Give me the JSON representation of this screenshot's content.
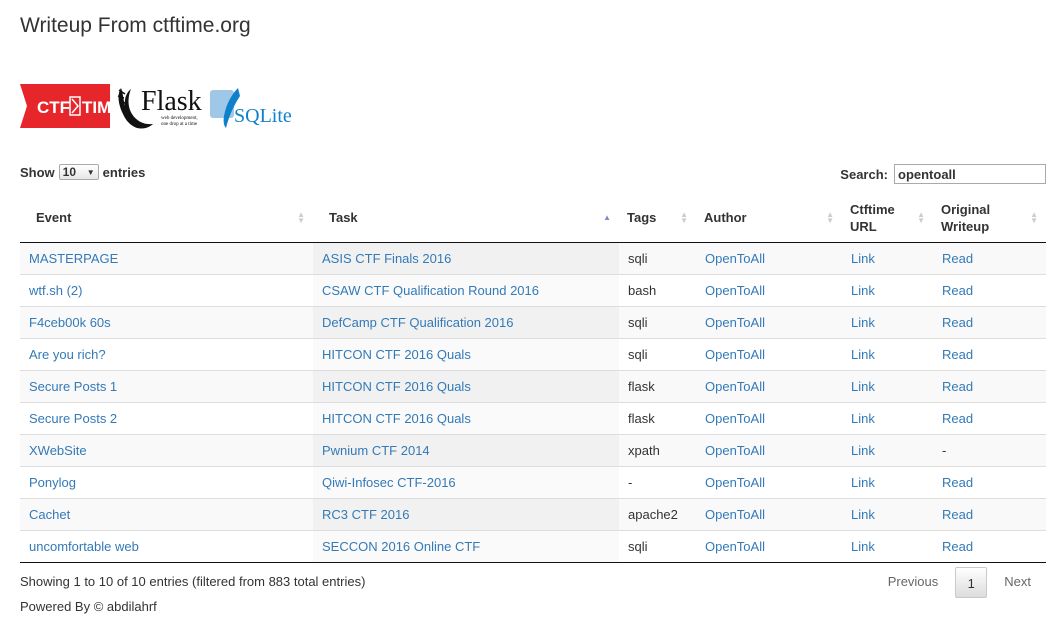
{
  "page": {
    "title": "Writeup From ctftime.org"
  },
  "logos": {
    "ctf_text": "CTF",
    "ctf_text2": "TIME",
    "flask_text": "Flask",
    "flask_tag1": "web development,",
    "flask_tag2": "one drop at a time",
    "sqlite_text": "SQLite"
  },
  "length": {
    "show_label": "Show",
    "value": "10",
    "entries_label": "entries"
  },
  "search": {
    "label": "Search:",
    "value": "opentoall"
  },
  "columns": {
    "event": "Event",
    "task": "Task",
    "tags": "Tags",
    "author": "Author",
    "ctf_line1": "Ctftime",
    "ctf_line2": "URL",
    "orig_line1": "Original",
    "orig_line2": "Writeup"
  },
  "rows": [
    {
      "event": "MASTERPAGE",
      "task": "ASIS CTF Finals 2016",
      "tags": "sqli",
      "author": "OpenToAll",
      "ctf_url": "Link",
      "writeup": "Read"
    },
    {
      "event": "wtf.sh (2)",
      "task": "CSAW CTF Qualification Round 2016",
      "tags": "bash",
      "author": "OpenToAll",
      "ctf_url": "Link",
      "writeup": "Read"
    },
    {
      "event": "F4ceb00k 60s",
      "task": "DefCamp CTF Qualification 2016",
      "tags": "sqli",
      "author": "OpenToAll",
      "ctf_url": "Link",
      "writeup": "Read"
    },
    {
      "event": "Are you rich?",
      "task": "HITCON CTF 2016 Quals",
      "tags": "sqli",
      "author": "OpenToAll",
      "ctf_url": "Link",
      "writeup": "Read"
    },
    {
      "event": "Secure Posts 1",
      "task": "HITCON CTF 2016 Quals",
      "tags": "flask",
      "author": "OpenToAll",
      "ctf_url": "Link",
      "writeup": "Read"
    },
    {
      "event": "Secure Posts 2",
      "task": "HITCON CTF 2016 Quals",
      "tags": "flask",
      "author": "OpenToAll",
      "ctf_url": "Link",
      "writeup": "Read"
    },
    {
      "event": "XWebSite",
      "task": "Pwnium CTF 2014",
      "tags": "xpath",
      "author": "OpenToAll",
      "ctf_url": "Link",
      "writeup": "-"
    },
    {
      "event": "Ponylog",
      "task": "Qiwi-Infosec CTF-2016",
      "tags": "-",
      "author": "OpenToAll",
      "ctf_url": "Link",
      "writeup": "Read"
    },
    {
      "event": "Cachet",
      "task": "RC3 CTF 2016",
      "tags": "apache2",
      "author": "OpenToAll",
      "ctf_url": "Link",
      "writeup": "Read"
    },
    {
      "event": "uncomfortable web",
      "task": "SECCON 2016 Online CTF",
      "tags": "sqli",
      "author": "OpenToAll",
      "ctf_url": "Link",
      "writeup": "Read"
    }
  ],
  "info": "Showing 1 to 10 of 10 entries (filtered from 883 total entries)",
  "pagination": {
    "previous": "Previous",
    "current": "1",
    "next": "Next"
  },
  "footer": "Powered By © abdilahrf",
  "colors": {
    "link": "#337ab7",
    "ctf_red": "#e6262b"
  }
}
